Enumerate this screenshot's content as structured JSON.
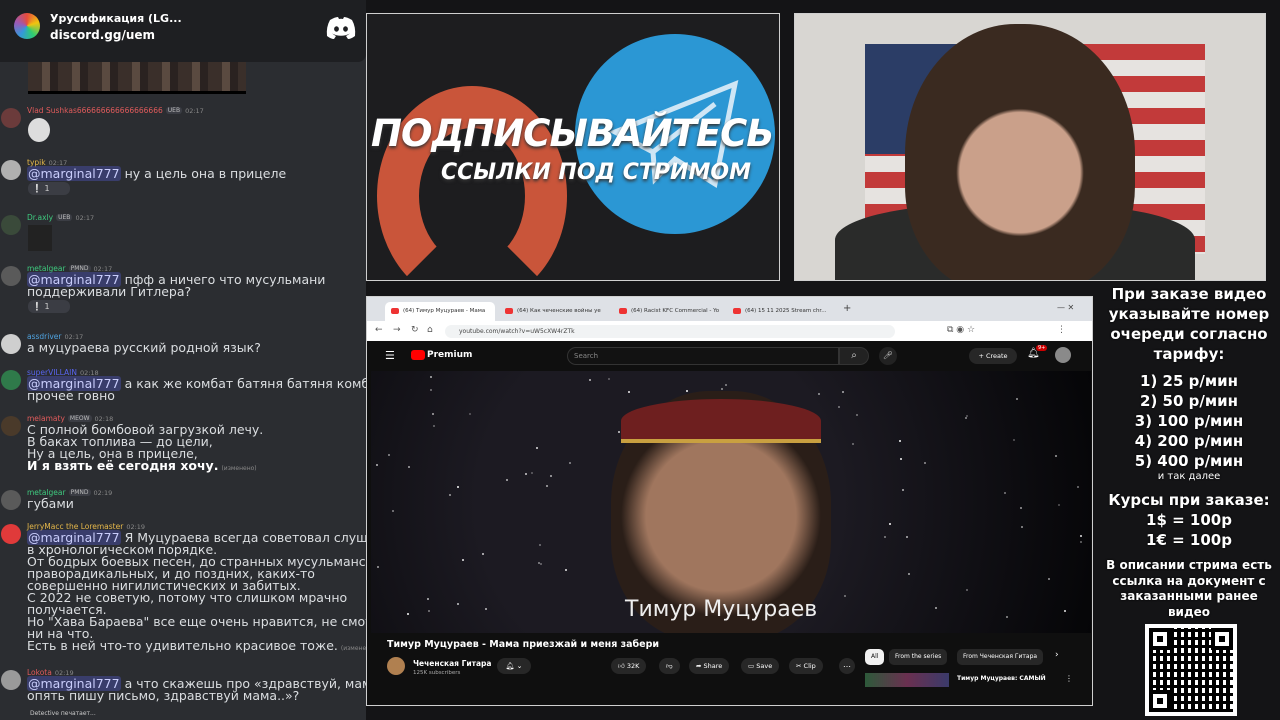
{
  "discord": {
    "title": "Урусификация (LG...",
    "invite": "discord.gg/uem",
    "brand_color": "#5865f2"
  },
  "messages": [
    {
      "user": "Vlad Sushkas",
      "color": "#e05b5b",
      "badge": "UEB",
      "extra": "666666666666666666",
      "time": "02:17",
      "lines": []
    },
    {
      "user": "typik",
      "color": "#e6b84a",
      "time": "02:17",
      "mention": "@marginal777",
      "lines": [
        "ну а цель она в прицеле"
      ],
      "reaction": "1"
    },
    {
      "user": "Dr.axly",
      "color": "#3ec97e",
      "badge": "UEB",
      "time": "02:17",
      "lines": []
    },
    {
      "user": "metalgear",
      "color": "#3ec97e",
      "badge": "PMND",
      "time": "02:17",
      "mention": "@marginal777",
      "lines": [
        "пфф а ничего что мусульмани",
        "поддерживали Гитлера?"
      ],
      "reaction": "1"
    },
    {
      "user": "assdriver",
      "color": "#4fa3e0",
      "time": "02:17",
      "lines": [
        "а муцураева русский родной язык?"
      ]
    },
    {
      "user": "superVILLAIN",
      "color": "#5865f2",
      "time": "02:18",
      "mention": "@marginal777",
      "lines": [
        "а как же комбат батяня батяня комбат и",
        "прочее говно"
      ]
    },
    {
      "user": "melamaty",
      "color": "#e05b5b",
      "badge": "MEOW",
      "time": "02:18",
      "lines": [
        "С полной бомбовой загрузкой лечу.",
        "В баках топлива — до цели,",
        "Ну а цель, она в прицеле,",
        "И я взять её сегодня хочу."
      ],
      "edited": "(изменено)"
    },
    {
      "user": "metalgear",
      "color": "#3ec97e",
      "badge": "PMND",
      "time": "02:19",
      "lines": [
        "губами"
      ]
    },
    {
      "user": "JerryMacc the Loremaster",
      "color": "#e6b84a",
      "time": "02:19",
      "mention": "@marginal777",
      "lines": [
        "Я Муцураева всегда советовал слушать",
        "в хронологическом порядке.",
        "От бодрых боевых песен, до странных мусульманско-",
        "праворадикальных, и до поздних, каких-то",
        "совершенно нигилистических и забитых.",
        "С 2022 не советую, потому что слишком мрачно",
        "получается.",
        "Но \"Хава Бараева\" все еще очень нравится, не смотря",
        "ни на что.",
        "Есть в ней что-то удивительно красивое тоже."
      ],
      "edited": "(изменено)"
    },
    {
      "user": "Lokota",
      "color": "#e05b5b",
      "time": "02:19",
      "mention": "@marginal777",
      "lines": [
        "а что скажешь про «здравствуй, мама, я",
        "опять пишу письмо, здравствуй мама..»?"
      ]
    }
  ],
  "typing": "Detective печатает...",
  "promo": {
    "line1": "ПОДПИСЫВАЙТЕСЬ",
    "line2": "ССЫЛКИ ПОД СТРИМОМ"
  },
  "browser": {
    "tabs": [
      "(64) Тимур Муцураев - Мама",
      "(64) Как чеченские войны уе",
      "(64) Racist KFC Commercial - Yo",
      "(64) 15 11 2025 Stream chr..."
    ],
    "url": "youtube.com/watch?v=uW5cXW4rZTk",
    "yt_brand": "Premium",
    "search_placeholder": "Search",
    "create_label": "Create",
    "notif_count": "9+",
    "video_caption": "Тимур Муцураев",
    "video_title": "Тимур Муцураев - Мама приезжай и меня забери",
    "channel_name": "Чеченская Гитара",
    "channel_subs": "125K subscribers",
    "likes": "32K",
    "share_label": "Share",
    "save_label": "Save",
    "clip_label": "Clip",
    "chips": [
      "All",
      "From the series",
      "From Чеченская Гитара"
    ],
    "rec_title": "Тимур Муцураев: САМЫЙ"
  },
  "info": {
    "intro": "При заказе видео указывайте номер очереди согласно тарифу:",
    "tariffs": [
      "1) 25 р/мин",
      "2) 50 р/мин",
      "3) 100 р/мин",
      "4) 200 р/мин",
      "5) 400 р/мин"
    ],
    "etc": "и так далее",
    "rates_heading": "Курсы при заказе:",
    "rates": [
      "1$ = 100р",
      "1€ = 100р"
    ],
    "doc_note": "В описании стрима есть ссылка на документ с заказанными ранее видео"
  }
}
